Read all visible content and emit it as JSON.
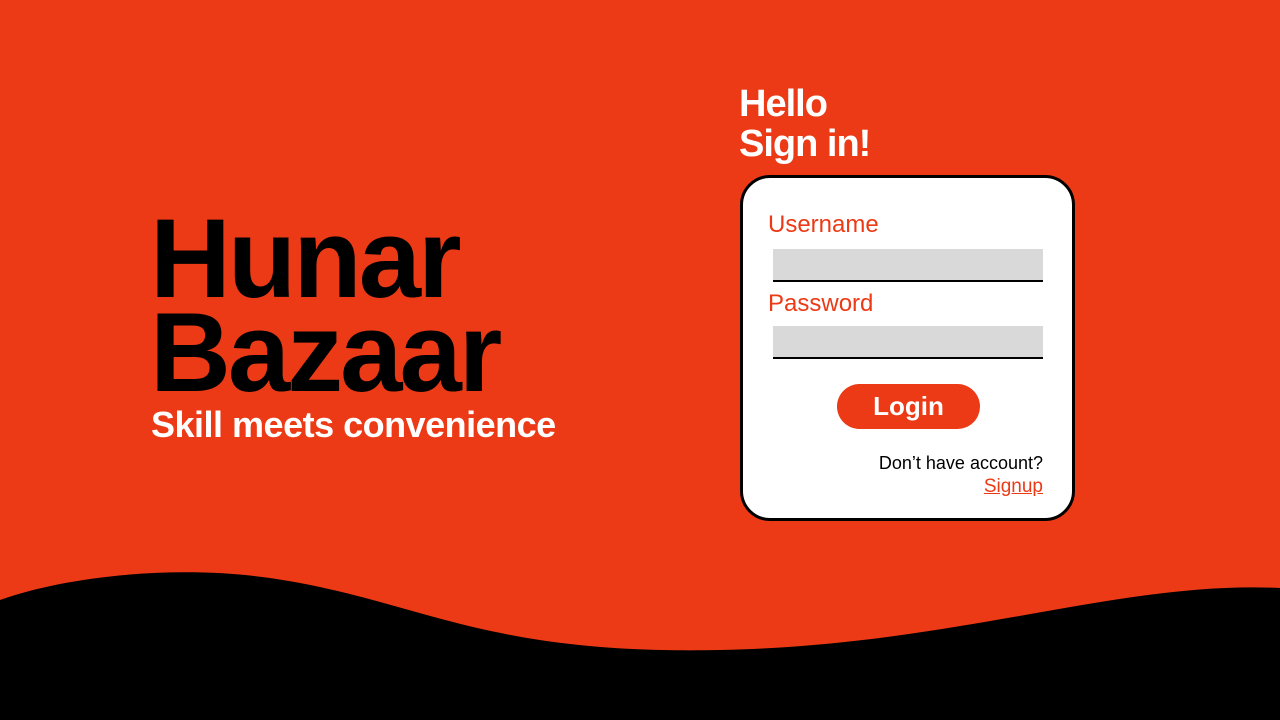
{
  "brand": {
    "line1": "Hunar",
    "line2": "Bazaar",
    "tagline": "Skill meets convenience"
  },
  "greeting": {
    "line1": "Hello",
    "line2": "Sign in!"
  },
  "login_form": {
    "username_label": "Username",
    "username_value": "",
    "password_label": "Password",
    "password_value": "",
    "login_label": "Login",
    "no_account_text": "Don’t have account?",
    "signup_label": "Signup"
  },
  "colors": {
    "background": "#ec3a16",
    "accent": "#ec3a16",
    "wave": "#000000",
    "card": "#ffffff",
    "input": "#d9d9d9"
  }
}
